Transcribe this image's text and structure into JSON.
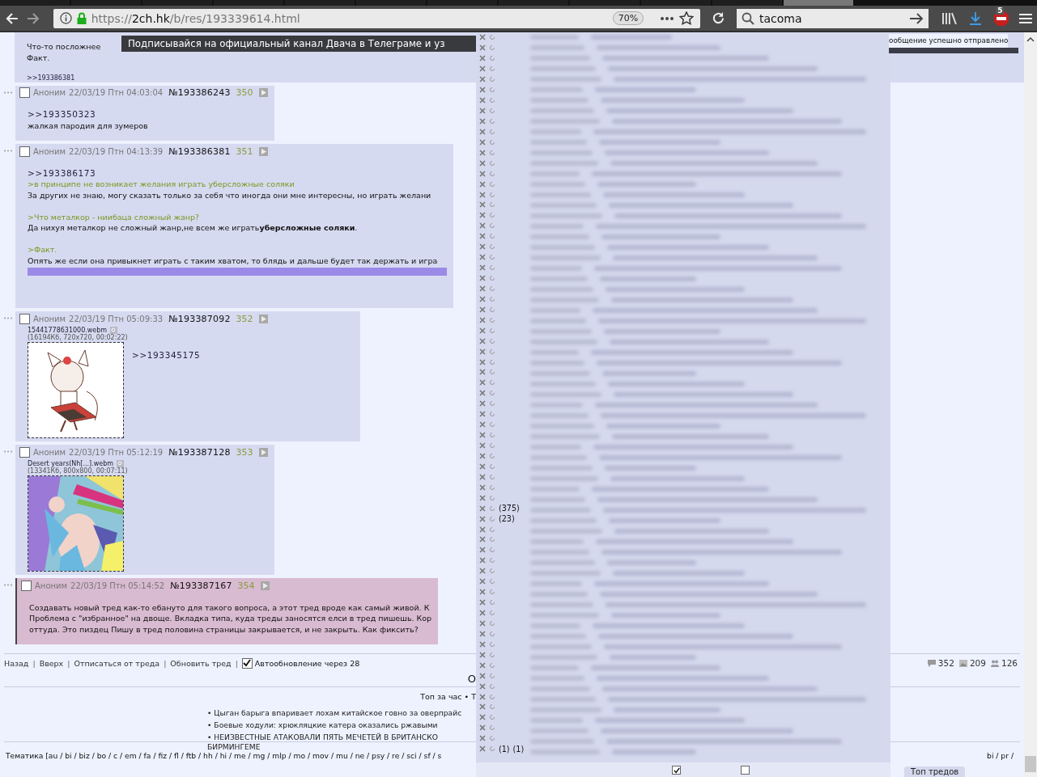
{
  "browser_tabs": [
    {
      "selected": false
    },
    {
      "selected": false
    },
    {
      "selected": false
    },
    {
      "selected": false
    },
    {
      "selected": false
    },
    {
      "selected": false
    },
    {
      "selected": false
    },
    {
      "selected": false
    },
    {
      "selected": false
    },
    {
      "selected": false
    },
    {
      "selected": false
    },
    {
      "selected": true
    }
  ],
  "browser": {
    "url_scheme": "https://",
    "url_host": "2ch.hk",
    "url_path": "/b/res/193339614.html",
    "zoom": "70%",
    "search": "tacoma",
    "badge": "5"
  },
  "banner": {
    "text": "Подписывайся на официальный канал Двача в Телеграме и уз"
  },
  "notice": {
    "text": "ообщение успешно отправлено"
  },
  "posts": [
    {
      "kind": "tail",
      "lines": [
        {
          "kind": "text",
          "text": "Что-то посложнее",
          "gap": false
        },
        {
          "kind": "text",
          "text": "Факт.",
          "gap": false
        },
        {
          "kind": "small-reply",
          "text": ">>193386381",
          "gap": true
        }
      ]
    },
    {
      "kind": "post",
      "checked": false,
      "highlighted": false,
      "name": "Аноним",
      "date": "22/03/19 Птн 04:03:04",
      "number": "№193386243",
      "count": "350",
      "lines": [
        {
          "kind": "reply",
          "text": ">>193350323",
          "gap": true
        },
        {
          "kind": "text",
          "text": "жалкая пародия для зумеров",
          "gap": false
        }
      ]
    },
    {
      "kind": "post",
      "checked": false,
      "highlighted": false,
      "name": "Аноним",
      "date": "22/03/19 Птн 04:13:39",
      "number": "№193386381",
      "count": "351",
      "lines": [
        {
          "kind": "reply",
          "text": ">>193386173",
          "gap": true
        },
        {
          "kind": "quote",
          "text": ">в принципе не возникает желания играть уберсложные соляки",
          "gap": false
        },
        {
          "kind": "text",
          "text": "За других не знаю, могу сказать только за себя что иногда они мне интересны, но играть желани",
          "gap": false
        },
        {
          "kind": "quote",
          "text": ">Что металкор - ниибаца сложный жанр?",
          "gap": true
        },
        {
          "kind": "text",
          "text": "Да нихуя металкор не сложный жанр,не всем же играть**уберсложные соляки**.",
          "gap": false
        },
        {
          "kind": "quote",
          "text": ">Факт.",
          "gap": true
        },
        {
          "kind": "text",
          "text": "Опять же если она привыкнет играть с таким хватом, то блядь и дальше будет так держать и игра",
          "gap": false
        },
        {
          "kind": "bar"
        }
      ]
    },
    {
      "kind": "post",
      "checked": false,
      "highlighted": false,
      "name": "Аноним",
      "date": "22/03/19 Птн 05:09:33",
      "number": "№193387092",
      "count": "352",
      "file": {
        "name": "15441778631000.webm",
        "info": "(16194Кб, 720x720, 00:02:22)"
      },
      "lines": [
        {
          "kind": "reply",
          "text": ">>193345175",
          "gap": false
        }
      ]
    },
    {
      "kind": "post",
      "checked": false,
      "highlighted": false,
      "name": "Аноним",
      "date": "22/03/19 Птн 05:12:19",
      "number": "№193387128",
      "count": "353",
      "file": {
        "name": "Desert years(Nh[...].webm",
        "info": "(13341Кб, 800x800, 00:07:11)"
      }
    },
    {
      "kind": "post",
      "checked": false,
      "highlighted": true,
      "name": "Аноним",
      "date": "22/03/19 Птн 05:14:52",
      "number": "№193387167",
      "count": "354",
      "lines": [
        {
          "kind": "text",
          "text": "Создавать новый тред как-то ебануто для такого вопроса, а этот тред вроде как самый живой. К",
          "gap": true
        },
        {
          "kind": "text",
          "text": "Проблема с \"избранное\" на двоще. Вкладка типа, куда треды заносятся елси в тред пишешь. Кор",
          "gap": false
        },
        {
          "kind": "text",
          "text": "оттуда. Это пиздец Пишу в тред половина страницы закрывается, и не закрыть. Как фиксить?",
          "gap": false
        }
      ]
    }
  ],
  "footer": {
    "nav": [
      {
        "kind": "link",
        "text": "Назад"
      },
      {
        "kind": "separator",
        "text": "|"
      },
      {
        "kind": "link",
        "text": "Вверх"
      },
      {
        "kind": "separator",
        "text": "|"
      },
      {
        "kind": "link",
        "text": "Отписаться от треда"
      },
      {
        "kind": "separator",
        "text": "|"
      },
      {
        "kind": "link",
        "text": "Обновить тред"
      },
      {
        "kind": "separator",
        "text": "|"
      }
    ],
    "autoupdate": {
      "label": "Автообновление через 28",
      "checked": true
    },
    "stats": [
      "352",
      "209",
      "126"
    ],
    "cut_title": "О",
    "top_label": "Топ за час • Т",
    "news": [
      {
        "lines": [
          "• Цыган барыга впаривает лохам китайское говно за оверпрайс"
        ]
      },
      {
        "lines": [
          "• Боевые ходули: хрюкляцкие катера оказались ржавыми"
        ]
      },
      {
        "lines": [
          "• НЕИЗВЕСТНЫЕ АТАКОВАЛИ ПЯТЬ МЕЧЕТЕЙ В БРИТАНСКО",
          "БИРМИНГЕМЕ"
        ]
      }
    ],
    "boards_left": "Тематика [au / bi / biz / bo / c / em / fa / fiz / fl / ftb / hh / hi / me / mg / mlp / mo / mov / mu / ne / psy / re / sci / sf / s",
    "boards_right": "bi / pr /"
  },
  "thread_panel": {
    "counts": [
      [
        "(375)"
      ],
      [
        "(23)"
      ],
      [
        "(1)",
        "(1)"
      ]
    ],
    "options": [
      {
        "checked": true
      },
      {
        "checked": false
      }
    ],
    "tab": "Топ тредов"
  }
}
